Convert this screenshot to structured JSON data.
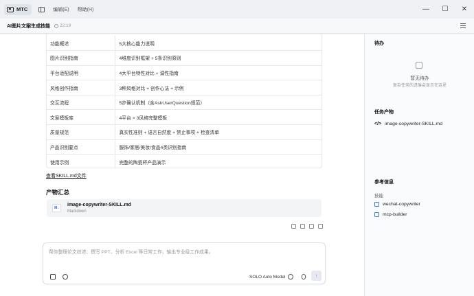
{
  "titlebar": {
    "app_name": "MTC",
    "menus": [
      "编辑(E)",
      "帮助(H)"
    ],
    "controls": {
      "minimize": "—",
      "maximize": "☐",
      "close": "✕"
    }
  },
  "header": {
    "title": "AI图片文案生成技能",
    "time": "22:19"
  },
  "spec_table": [
    {
      "key": "功能概述",
      "value": "5大核心能力说明"
    },
    {
      "key": "图片识别指南",
      "value": "4维度识别框架 + 5条识别原则"
    },
    {
      "key": "平台适配说明",
      "value": "4大平台特性对比 + 调性指南"
    },
    {
      "key": "风格创作指南",
      "value": "3种风格对比 + 创作心法 + 示例"
    },
    {
      "key": "交互流程",
      "value": "5步确认机制（含AskUserQuestion规范）"
    },
    {
      "key": "文案模板库",
      "value": "4平台 × 3风格完整模板"
    },
    {
      "key": "质量规范",
      "value": "真实性准则 + 语言自然度 + 禁止事项 + 检查清单"
    },
    {
      "key": "产品识别要点",
      "value": "服饰/家居/美妆/食品4类识别指南"
    },
    {
      "key": "使用示例",
      "value": "完整的陶瓷杯产品演示"
    }
  ],
  "link_text": "查看SKILL.md文件",
  "artifacts_title": "产物汇总",
  "file_card": {
    "name": "image-copywriter-SKILL.md",
    "type": "Markdown",
    "icon_text": "M↓"
  },
  "composer": {
    "placeholder": "帮你整理论文综述、撰写 PPT、分析 Excel 等日常工作，输出专业级工作成果。",
    "model": "SOLO Auto Model",
    "send": "↑"
  },
  "sidebar": {
    "todo_title": "待办",
    "empty_title": "暂无待办",
    "empty_sub": "复杂任务的进展会显示在这里",
    "artifacts_title": "任务产物",
    "artifact_file": "image-copywriter-SKILL.md",
    "artifact_icon": "</>",
    "ref_title": "参考信息",
    "skills_label": "技能",
    "skills": [
      "wechat-copywriter",
      "mcp-builder"
    ]
  }
}
